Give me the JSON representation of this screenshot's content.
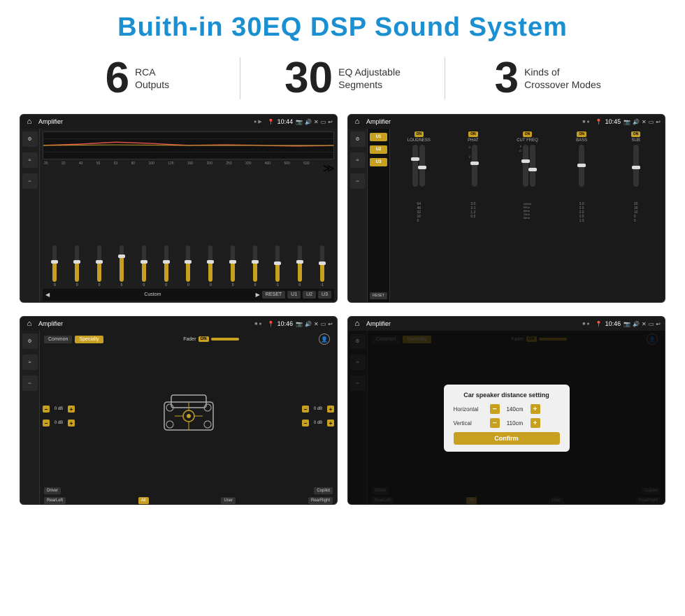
{
  "page": {
    "title": "Buith-in 30EQ DSP Sound System"
  },
  "stats": [
    {
      "number": "6",
      "text_line1": "RCA",
      "text_line2": "Outputs"
    },
    {
      "number": "30",
      "text_line1": "EQ Adjustable",
      "text_line2": "Segments"
    },
    {
      "number": "3",
      "text_line1": "Kinds of",
      "text_line2": "Crossover Modes"
    }
  ],
  "screen1": {
    "app_title": "Amplifier",
    "time": "10:44",
    "eq_labels": [
      "25",
      "32",
      "40",
      "50",
      "63",
      "80",
      "100",
      "125",
      "160",
      "200",
      "250",
      "320",
      "400",
      "500",
      "630"
    ],
    "eq_values": [
      "0",
      "0",
      "0",
      "5",
      "0",
      "0",
      "0",
      "0",
      "0",
      "0",
      "-1",
      "0",
      "-1"
    ],
    "bottom_btns": [
      "Custom",
      "RESET",
      "U1",
      "U2",
      "U3"
    ]
  },
  "screen2": {
    "app_title": "Amplifier",
    "time": "10:45",
    "channels": [
      "U1",
      "U2",
      "U3"
    ],
    "on_labels": [
      "ON",
      "ON",
      "ON",
      "ON",
      "ON"
    ],
    "col_titles": [
      "LOUDNESS",
      "PHAT",
      "CUT FREQ",
      "BASS",
      "SUB"
    ],
    "reset_label": "RESET"
  },
  "screen3": {
    "app_title": "Amplifier",
    "time": "10:46",
    "tab_common": "Common",
    "tab_specialty": "Specialty",
    "fader_label": "Fader",
    "on_label": "ON",
    "db_values": [
      "0 dB",
      "0 dB",
      "0 dB",
      "0 dB"
    ],
    "bottom_btns": [
      "Driver",
      "Copilot",
      "RearLeft",
      "All",
      "User",
      "RearRight"
    ]
  },
  "screen4": {
    "app_title": "Amplifier",
    "time": "10:46",
    "tab_common": "Common",
    "tab_specialty": "Specialty",
    "dialog_title": "Car speaker distance setting",
    "horizontal_label": "Horizontal",
    "horizontal_value": "140cm",
    "vertical_label": "Vertical",
    "vertical_value": "110cm",
    "confirm_label": "Confirm",
    "bottom_btns": [
      "Driver",
      "Copilot",
      "RearLeft",
      "All",
      "User",
      "RearRight"
    ]
  },
  "icons": {
    "home": "⌂",
    "play": "▶",
    "back_arrow": "↩",
    "location": "📍",
    "speaker": "🔊",
    "camera": "📷",
    "x_icon": "✕",
    "minus_icon": "−",
    "plus_icon": "+",
    "equalizer": "≡",
    "wave": "〜",
    "arrows": "⇔"
  }
}
